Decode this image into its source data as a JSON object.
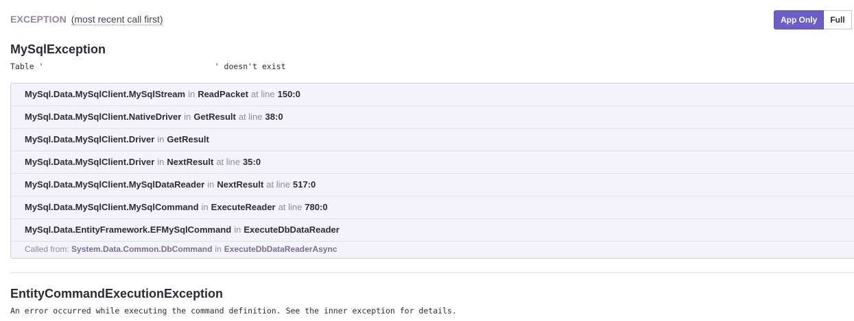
{
  "header": {
    "label": "EXCEPTION",
    "sublabel": "(most recent call first)"
  },
  "toggle": {
    "app_only": "App Only",
    "full": "Full"
  },
  "exceptions": [
    {
      "type": "MySqlException",
      "message": "Table '                                    ' doesn't exist",
      "frames": [
        {
          "module": "MySql.Data.MySqlClient.MySqlStream",
          "in": "in",
          "function": "ReadPacket",
          "at": "at line",
          "line": "150:0"
        },
        {
          "module": "MySql.Data.MySqlClient.NativeDriver",
          "in": "in",
          "function": "GetResult",
          "at": "at line",
          "line": "38:0"
        },
        {
          "module": "MySql.Data.MySqlClient.Driver",
          "in": "in",
          "function": "GetResult",
          "at": "",
          "line": ""
        },
        {
          "module": "MySql.Data.MySqlClient.Driver",
          "in": "in",
          "function": "NextResult",
          "at": "at line",
          "line": "35:0"
        },
        {
          "module": "MySql.Data.MySqlClient.MySqlDataReader",
          "in": "in",
          "function": "NextResult",
          "at": "at line",
          "line": "517:0"
        },
        {
          "module": "MySql.Data.MySqlClient.MySqlCommand",
          "in": "in",
          "function": "ExecuteReader",
          "at": "at line",
          "line": "780:0"
        },
        {
          "module": "MySql.Data.EntityFramework.EFMySqlCommand",
          "in": "in",
          "function": "ExecuteDbDataReader",
          "at": "",
          "line": ""
        }
      ],
      "called_from": {
        "prefix": "Called from:",
        "module": "System.Data.Common.DbCommand",
        "in": "in",
        "function": "ExecuteDbDataReaderAsync"
      }
    },
    {
      "type": "EntityCommandExecutionException",
      "message": "An error occurred while executing the command definition. See the inner exception for details."
    }
  ]
}
